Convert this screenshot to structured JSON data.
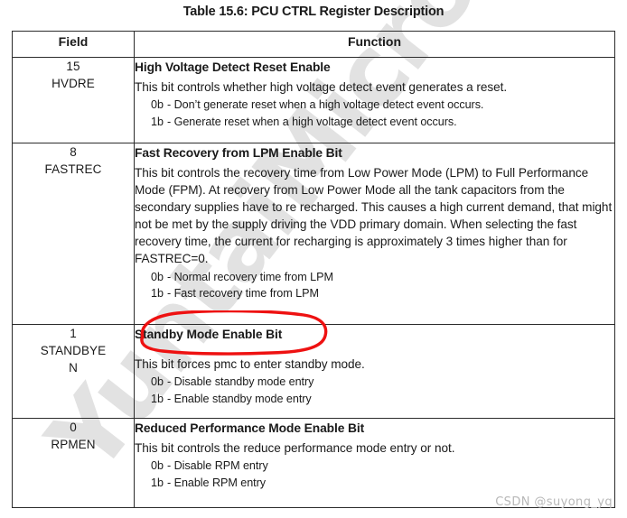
{
  "document": {
    "title": "Table 15.6:  PCU CTRL Register Description",
    "watermark": "YuntaiMicroelectr",
    "credit": "CSDN @suyong_yq"
  },
  "annotations": {
    "red_ellipse": {
      "color": "#ee1111",
      "target": "Standby Mode Enable Bit"
    }
  },
  "table": {
    "columns": [
      "Field",
      "Function"
    ],
    "rows": [
      {
        "bit": "15",
        "name": "HVDRE",
        "heading": "High Voltage Detect Reset Enable",
        "body": "This bit controls whether high voltage detect event generates a reset.",
        "values": [
          {
            "code": "0b",
            "desc": "- Don’t generate reset when a high voltage detect event occurs."
          },
          {
            "code": "1b",
            "desc": "- Generate reset when a high voltage detect event occurs."
          }
        ]
      },
      {
        "bit": "8",
        "name": "FASTREC",
        "heading": "Fast Recovery from LPM Enable Bit",
        "body": "This bit controls the recovery time from Low Power Mode (LPM) to Full Performance Mode (FPM). At recovery from Low Power Mode all the tank capacitors from the secondary supplies have to re recharged. This causes a high current demand, that might not be met by the supply driving the VDD primary domain. When selecting the fast recovery time, the current for recharging is approximately 3 times higher than for FASTREC=0.",
        "values": [
          {
            "code": "0b",
            "desc": "- Normal recovery time from LPM"
          },
          {
            "code": "1b",
            "desc": "- Fast recovery time from LPM"
          }
        ]
      },
      {
        "bit": "1",
        "name": "STANDBYE N",
        "name_line1": "STANDBYE",
        "name_line2": "N",
        "heading": "Standby Mode Enable Bit",
        "body": "This bit forces pmc to enter standby mode.",
        "values": [
          {
            "code": "0b",
            "desc": "- Disable standby mode entry"
          },
          {
            "code": "1b",
            "desc": "- Enable standby mode entry"
          }
        ]
      },
      {
        "bit": "0",
        "name": "RPMEN",
        "heading": "Reduced Performance Mode Enable Bit",
        "body": "This bit controls the reduce performance mode entry or not.",
        "values": [
          {
            "code": "0b",
            "desc": "- Disable RPM entry"
          },
          {
            "code": "1b",
            "desc": "- Enable RPM entry"
          }
        ]
      }
    ]
  }
}
